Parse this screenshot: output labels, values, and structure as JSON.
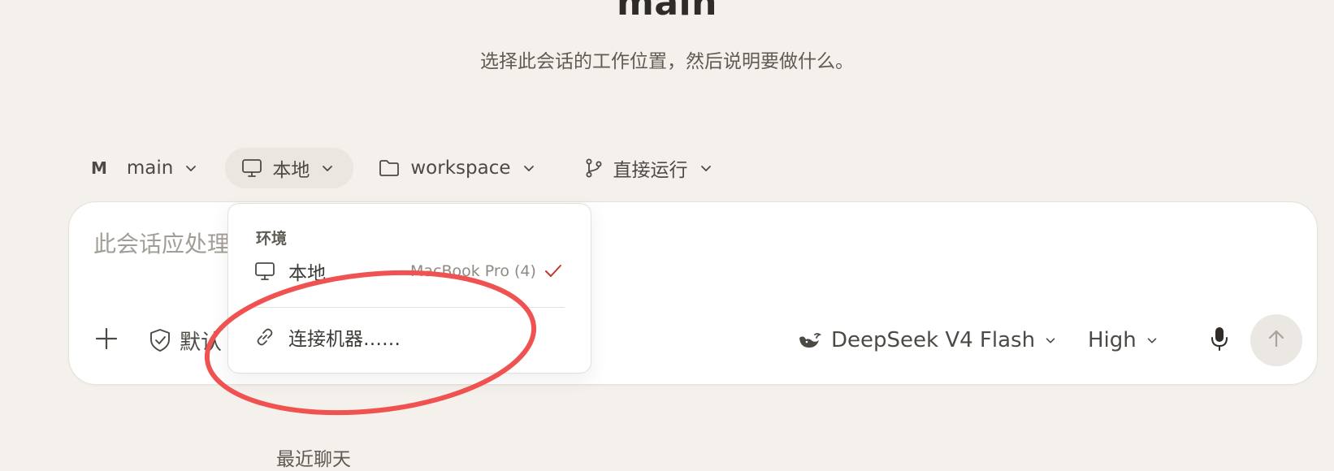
{
  "header": {
    "title": "main",
    "subtitle": "选择此会话的工作位置，然后说明要做什么。"
  },
  "toolbar": {
    "repo_badge": "M",
    "repo_label": "main",
    "environment_label": "本地",
    "workspace_label": "workspace",
    "run_mode_label": "直接运行"
  },
  "composer": {
    "placeholder": "此会话应处理",
    "permission_label": "默认",
    "model_label": "DeepSeek V4 Flash",
    "effort_label": "High"
  },
  "environment_menu": {
    "header": "环境",
    "items": [
      {
        "label": "本地",
        "machine": "MacBook Pro (4)",
        "selected": true
      },
      {
        "label": "连接机器……"
      }
    ]
  },
  "recent": {
    "heading": "最近聊天"
  },
  "colors": {
    "background": "#f4f1ec",
    "card": "#ffffff",
    "check_accent": "#c0392b",
    "annotation_red": "#f05252"
  },
  "icons": {
    "environment": "monitor-icon",
    "workspace": "folder-icon",
    "run_mode": "git-branch-icon",
    "add": "plus-icon",
    "permission": "shield-check-icon",
    "model": "whale-icon",
    "voice": "microphone-icon",
    "send": "arrow-up-icon",
    "connect": "link-icon",
    "selected": "check-icon"
  }
}
